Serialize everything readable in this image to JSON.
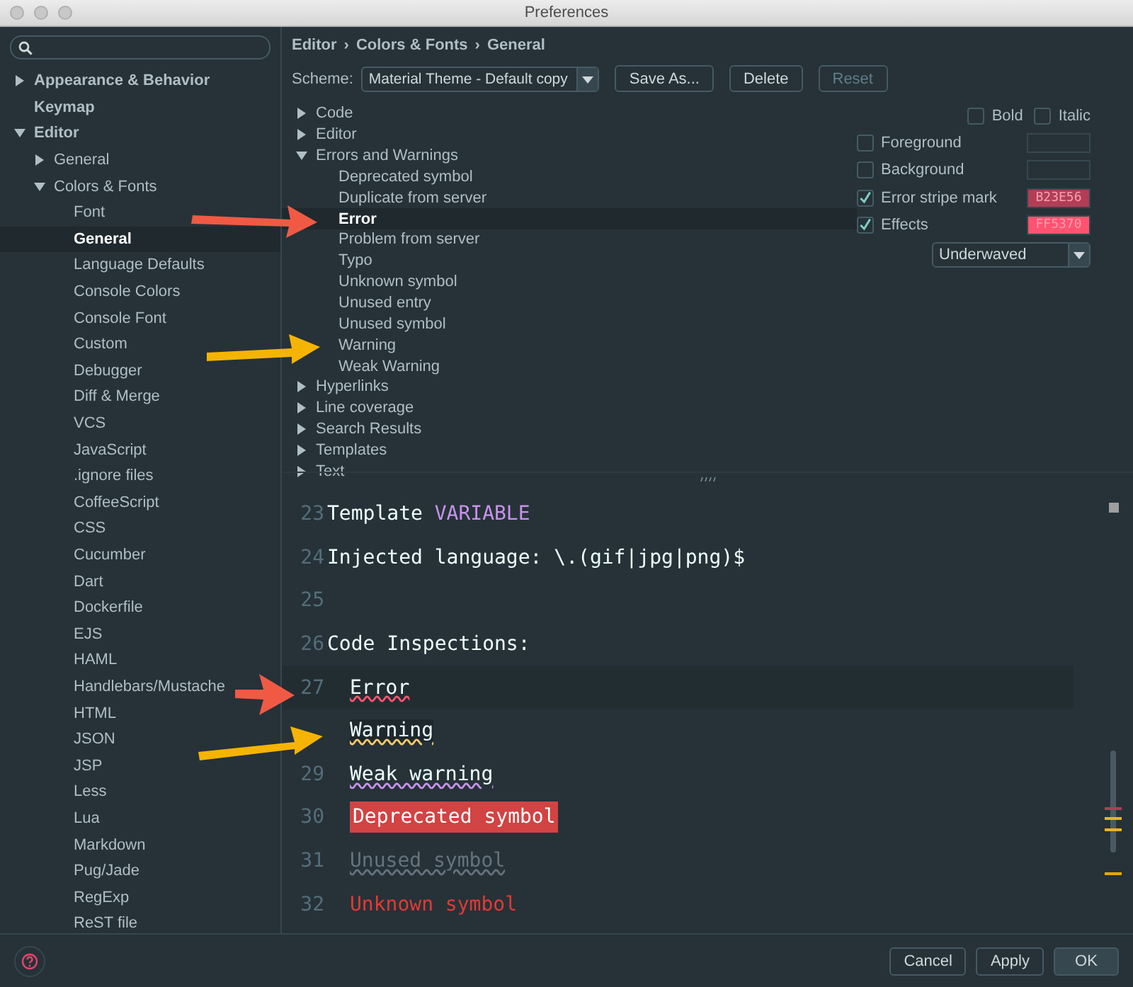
{
  "window": {
    "title": "Preferences"
  },
  "sidebar": {
    "items": [
      {
        "label": "Appearance & Behavior",
        "expanded": false,
        "selected": false
      },
      {
        "label": "Keymap",
        "selected": false
      },
      {
        "label": "Editor",
        "expanded": true,
        "selected": false,
        "children": [
          {
            "label": "General",
            "expanded": false,
            "selected": false
          },
          {
            "label": "Colors & Fonts",
            "expanded": true,
            "selected": false,
            "children": [
              {
                "label": "Font",
                "selected": false
              },
              {
                "label": "General",
                "selected": true
              },
              {
                "label": "Language Defaults",
                "selected": false
              },
              {
                "label": "Console Colors",
                "selected": false
              },
              {
                "label": "Console Font",
                "selected": false
              },
              {
                "label": "Custom",
                "selected": false
              },
              {
                "label": "Debugger",
                "selected": false
              },
              {
                "label": "Diff & Merge",
                "selected": false
              },
              {
                "label": "VCS",
                "selected": false
              },
              {
                "label": "JavaScript",
                "selected": false
              },
              {
                "label": ".ignore files",
                "selected": false
              },
              {
                "label": "CoffeeScript",
                "selected": false
              },
              {
                "label": "CSS",
                "selected": false
              },
              {
                "label": "Cucumber",
                "selected": false
              },
              {
                "label": "Dart",
                "selected": false
              },
              {
                "label": "Dockerfile",
                "selected": false
              },
              {
                "label": "EJS",
                "selected": false
              },
              {
                "label": "HAML",
                "selected": false
              },
              {
                "label": "Handlebars/Mustache",
                "selected": false
              },
              {
                "label": "HTML",
                "selected": false
              },
              {
                "label": "JSON",
                "selected": false
              },
              {
                "label": "JSP",
                "selected": false
              },
              {
                "label": "Less",
                "selected": false
              },
              {
                "label": "Lua",
                "selected": false
              },
              {
                "label": "Markdown",
                "selected": false
              },
              {
                "label": "Pug/Jade",
                "selected": false
              },
              {
                "label": "RegExp",
                "selected": false
              },
              {
                "label": "ReST file",
                "selected": false
              }
            ]
          }
        ]
      }
    ]
  },
  "breadcrumb": [
    "Editor",
    "›",
    "Colors & Fonts",
    "›",
    "General"
  ],
  "scheme": {
    "label": "Scheme:",
    "value": "Material Theme - Default copy",
    "buttons": [
      {
        "label": "Save As...",
        "disabled": false
      },
      {
        "label": "Delete",
        "disabled": false
      },
      {
        "label": "Reset",
        "disabled": true
      }
    ]
  },
  "tree": [
    {
      "label": "Code",
      "expanded": false,
      "selected": false
    },
    {
      "label": "Editor",
      "expanded": false,
      "selected": false
    },
    {
      "label": "Errors and Warnings",
      "expanded": true,
      "selected": false,
      "children": [
        {
          "label": "Deprecated symbol",
          "selected": false
        },
        {
          "label": "Duplicate from server",
          "selected": false
        },
        {
          "label": "Error",
          "selected": true
        },
        {
          "label": "Problem from server",
          "selected": false
        },
        {
          "label": "Typo",
          "selected": false
        },
        {
          "label": "Unknown symbol",
          "selected": false
        },
        {
          "label": "Unused entry",
          "selected": false
        },
        {
          "label": "Unused symbol",
          "selected": false
        },
        {
          "label": "Warning",
          "selected": false
        },
        {
          "label": "Weak Warning",
          "selected": false
        }
      ]
    },
    {
      "label": "Hyperlinks",
      "expanded": false,
      "selected": false
    },
    {
      "label": "Line coverage",
      "expanded": false,
      "selected": false
    },
    {
      "label": "Search Results",
      "expanded": false,
      "selected": false
    },
    {
      "label": "Templates",
      "expanded": false,
      "selected": false
    },
    {
      "label": "Text",
      "expanded": false,
      "selected": false
    }
  ],
  "properties": {
    "style_options": [
      {
        "label": "Bold",
        "checked": false
      },
      {
        "label": "Italic",
        "checked": false
      }
    ],
    "attributes": [
      {
        "label": "Foreground",
        "checked": false
      },
      {
        "label": "Background",
        "checked": false
      },
      {
        "label": "Error stripe mark",
        "checked": true,
        "value": "B23E56",
        "color": "#b23e56"
      },
      {
        "label": "Effects",
        "checked": true,
        "value": "FF5370",
        "color": "#ff5370"
      }
    ],
    "effect_type": "Underwaved"
  },
  "preview": [
    {
      "number": "23",
      "current": false,
      "spans": [
        {
          "text": "Template ",
          "kind": "plain"
        },
        {
          "text": "VARIABLE",
          "kind": "variable"
        }
      ]
    },
    {
      "number": "24",
      "current": false,
      "spans": [
        {
          "text": "Injected language: ",
          "kind": "plain"
        },
        {
          "text": "\\.(gif|jpg|png)$",
          "kind": "injected"
        }
      ]
    },
    {
      "number": "25",
      "current": false
    },
    {
      "number": "26",
      "current": false,
      "spans": [
        {
          "text": "Code Inspections:",
          "kind": "plain"
        }
      ]
    },
    {
      "number": "27",
      "current": true,
      "spans": [
        {
          "text": "Error",
          "kind": "error"
        }
      ]
    },
    {
      "current": false,
      "spans": [
        {
          "text": "Warning",
          "kind": "warning"
        }
      ]
    },
    {
      "number": "29",
      "current": false,
      "spans": [
        {
          "text": "Weak warning",
          "kind": "weak"
        }
      ]
    },
    {
      "number": "30",
      "current": false,
      "spans": [
        {
          "text": "Deprecated symbol",
          "kind": "deprecated"
        }
      ]
    },
    {
      "number": "31",
      "current": false,
      "spans": [
        {
          "text": "Unused symbol",
          "kind": "unused"
        }
      ]
    },
    {
      "number": "32",
      "current": false,
      "spans": [
        {
          "text": "Unknown symbol",
          "kind": "unknown"
        }
      ]
    }
  ],
  "footer": {
    "buttons": [
      {
        "label": "Cancel",
        "default": false
      },
      {
        "label": "Apply",
        "default": false
      },
      {
        "label": "OK",
        "default": true
      }
    ]
  }
}
